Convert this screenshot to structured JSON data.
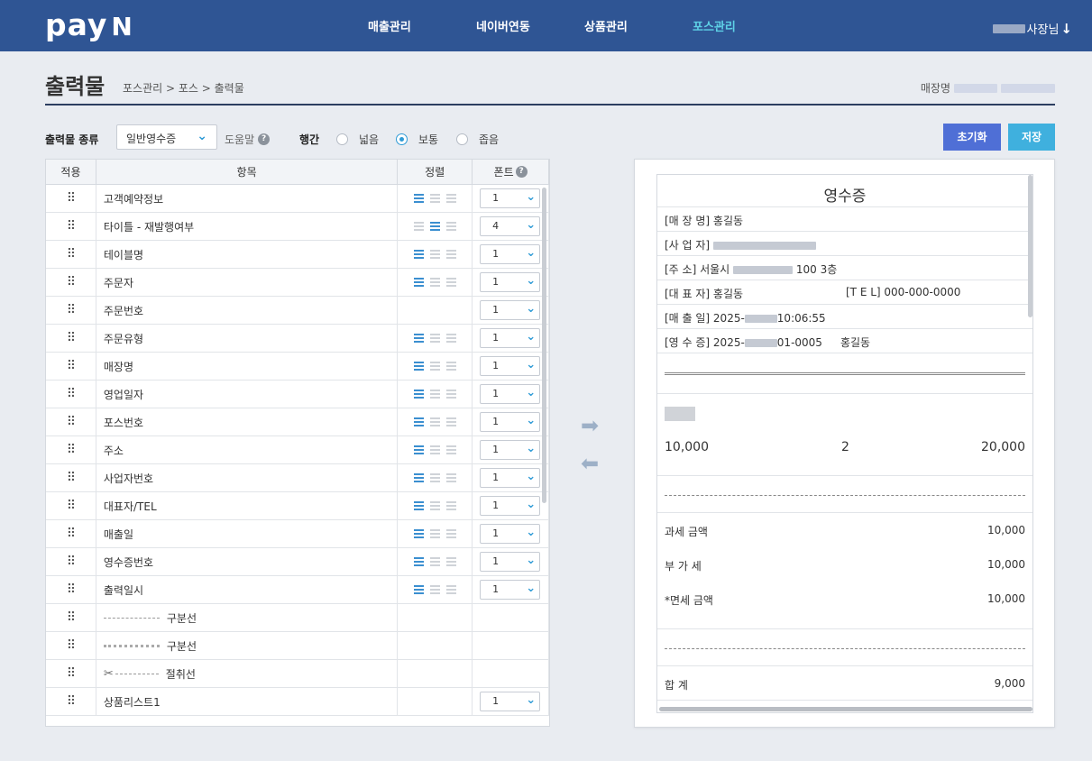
{
  "header": {
    "logo": "pay",
    "logo_n": "N",
    "nav": [
      "매출관리",
      "네이버연동",
      "상품관리",
      "포스관리"
    ],
    "active_nav": "포스관리",
    "user_suffix": "사장님",
    "user_icon": "arrow-down-icon"
  },
  "page": {
    "title": "출력물",
    "breadcrumb": "포스관리 > 포스 > 출력물",
    "store_label": "매장명"
  },
  "controls": {
    "type_label": "출력물 종류",
    "type_value": "일반영수증",
    "help_label": "도움말",
    "spacing_label": "행간",
    "spacing_options": [
      "넓음",
      "보통",
      "좁음"
    ],
    "spacing_selected": "보통",
    "reset_label": "초기화",
    "save_label": "저장"
  },
  "table": {
    "headers": [
      "적용",
      "항목",
      "정렬",
      "폰트"
    ],
    "rows": [
      {
        "name": "고객예약정보",
        "align": "left",
        "font": "1"
      },
      {
        "name": "타이틀 - 재발행여부",
        "align": "center",
        "font": "4"
      },
      {
        "name": "테이블명",
        "align": "left",
        "font": "1"
      },
      {
        "name": "주문자",
        "align": "left",
        "font": "1"
      },
      {
        "name": "주문번호",
        "align": "",
        "font": "1"
      },
      {
        "name": "주문유형",
        "align": "left",
        "font": "1"
      },
      {
        "name": "매장명",
        "align": "left",
        "font": "1"
      },
      {
        "name": "영업일자",
        "align": "left",
        "font": "1"
      },
      {
        "name": "포스번호",
        "align": "left",
        "font": "1"
      },
      {
        "name": "주소",
        "align": "left",
        "font": "1"
      },
      {
        "name": "사업자번호",
        "align": "left",
        "font": "1"
      },
      {
        "name": "대표자/TEL",
        "align": "left",
        "font": "1"
      },
      {
        "name": "매출일",
        "align": "left",
        "font": "1"
      },
      {
        "name": "영수증번호",
        "align": "left",
        "font": "1"
      },
      {
        "name": "출력일시",
        "align": "left",
        "font": "1"
      },
      {
        "name": "구분선",
        "divider": "dash",
        "font": ""
      },
      {
        "name": "구분선",
        "divider": "dotted",
        "font": ""
      },
      {
        "name": "절취선",
        "divider": "scissor",
        "font": ""
      },
      {
        "name": "상품리스트1",
        "align": "",
        "font": "1"
      }
    ]
  },
  "receipt": {
    "title": "영수증",
    "store": "[매 장 명] 홍길동",
    "biz": "[사 업 자]",
    "addr_prefix": "[주      소] 서울시",
    "addr_suffix": "100 3층",
    "ceo": "[대  표  자] 홍길동",
    "tel": "[T   E   L] 000-000-0000",
    "sale_prefix": "[매 출 일] 2025-",
    "sale_suffix": "10:06:55",
    "rcpt_prefix": "[영 수 증] 2025-",
    "rcpt_suffix": "01-0005",
    "rcpt_name": "홍길동",
    "price": "10,000",
    "qty": "2",
    "amount": "20,000",
    "tax_label": "과세 금액",
    "tax_value": "10,000",
    "vat_label": "부   가   세",
    "vat_value": "10,000",
    "free_label": "*면세 금액",
    "free_value": "10,000",
    "total_label": "합      계",
    "total_value": "9,000"
  },
  "colors": {
    "header_bg": "#2f5594",
    "active_nav": "#5ed1e6",
    "reset_btn": "#4f6fd6",
    "save_btn": "#3fb0de"
  }
}
